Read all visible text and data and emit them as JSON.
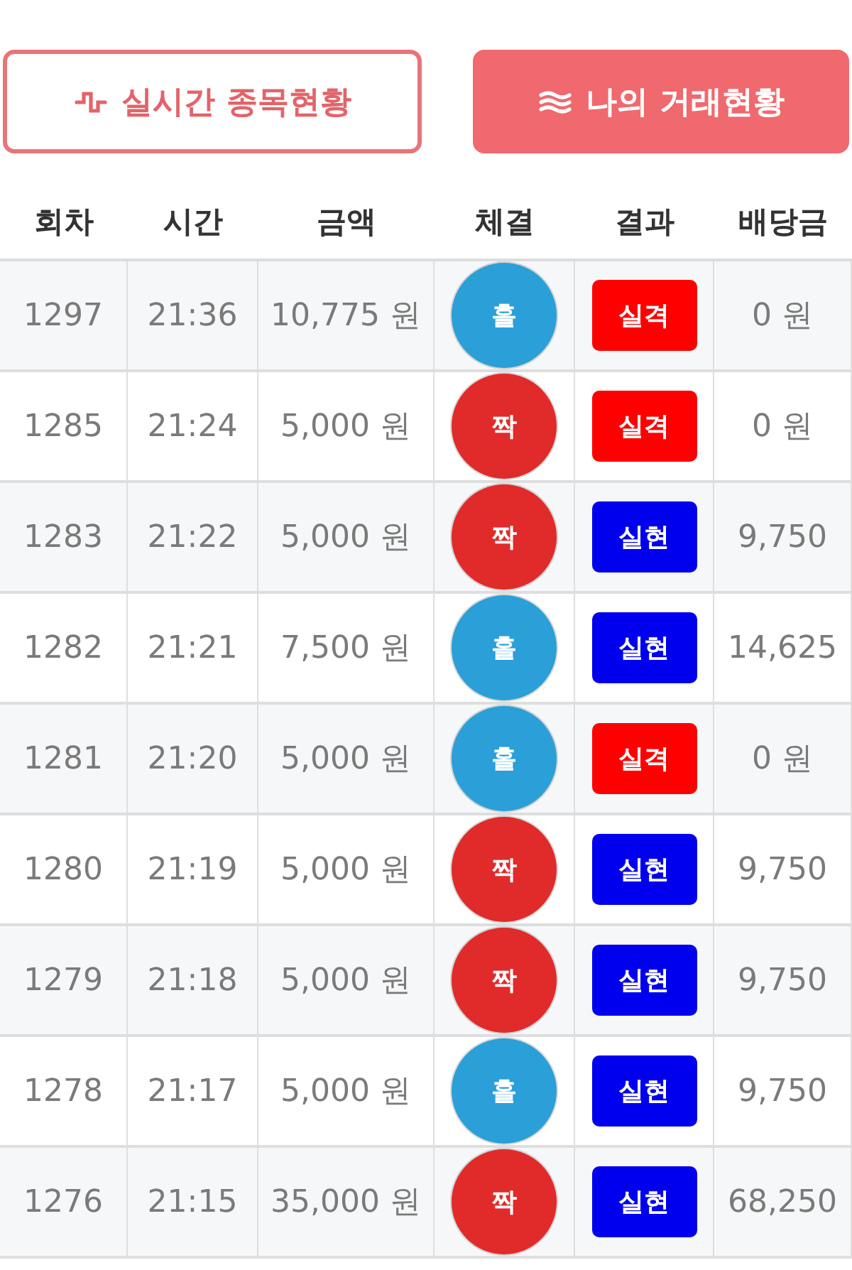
{
  "tabs": [
    {
      "label": "실시간 종목현황",
      "kind": "pulse",
      "selected": false
    },
    {
      "label": "나의 거래현황",
      "kind": "waves",
      "selected": true
    }
  ],
  "table": {
    "columns": [
      "회차",
      "시간",
      "금액",
      "체결",
      "결과",
      "배당금"
    ],
    "rows": [
      {
        "round": "1297",
        "time": "21:36",
        "amount": "10,775 원",
        "pick": {
          "label": "홀",
          "color": "#2a9fd8"
        },
        "result": {
          "label": "실격",
          "color": "#ff0000"
        },
        "payout": "0 원"
      },
      {
        "round": "1285",
        "time": "21:24",
        "amount": "5,000 원",
        "pick": {
          "label": "짝",
          "color": "#e12a2a"
        },
        "result": {
          "label": "실격",
          "color": "#ff0000"
        },
        "payout": "0 원"
      },
      {
        "round": "1283",
        "time": "21:22",
        "amount": "5,000 원",
        "pick": {
          "label": "짝",
          "color": "#e12a2a"
        },
        "result": {
          "label": "실현",
          "color": "#0000ee"
        },
        "payout": "9,750"
      },
      {
        "round": "1282",
        "time": "21:21",
        "amount": "7,500 원",
        "pick": {
          "label": "홀",
          "color": "#2a9fd8"
        },
        "result": {
          "label": "실현",
          "color": "#0000ee"
        },
        "payout": "14,625"
      },
      {
        "round": "1281",
        "time": "21:20",
        "amount": "5,000 원",
        "pick": {
          "label": "홀",
          "color": "#2a9fd8"
        },
        "result": {
          "label": "실격",
          "color": "#ff0000"
        },
        "payout": "0 원"
      },
      {
        "round": "1280",
        "time": "21:19",
        "amount": "5,000 원",
        "pick": {
          "label": "짝",
          "color": "#e12a2a"
        },
        "result": {
          "label": "실현",
          "color": "#0000ee"
        },
        "payout": "9,750"
      },
      {
        "round": "1279",
        "time": "21:18",
        "amount": "5,000 원",
        "pick": {
          "label": "짝",
          "color": "#e12a2a"
        },
        "result": {
          "label": "실현",
          "color": "#0000ee"
        },
        "payout": "9,750"
      },
      {
        "round": "1278",
        "time": "21:17",
        "amount": "5,000 원",
        "pick": {
          "label": "홀",
          "color": "#2a9fd8"
        },
        "result": {
          "label": "실현",
          "color": "#0000ee"
        },
        "payout": "9,750"
      },
      {
        "round": "1276",
        "time": "21:15",
        "amount": "35,000 원",
        "pick": {
          "label": "짝",
          "color": "#e12a2a"
        },
        "result": {
          "label": "실현",
          "color": "#0000ee"
        },
        "payout": "68,250"
      }
    ]
  }
}
